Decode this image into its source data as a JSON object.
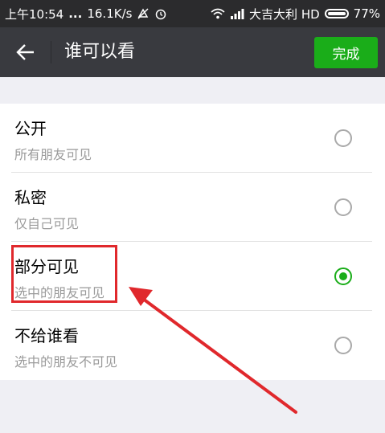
{
  "status_bar": {
    "time": "上午10:54",
    "dots": "...",
    "speed": "16.1K/s",
    "carrier": "大吉大利 HD",
    "battery": "77%"
  },
  "title_bar": {
    "title": "谁可以看",
    "done_label": "完成"
  },
  "options": [
    {
      "title": "公开",
      "subtitle": "所有朋友可见",
      "selected": false
    },
    {
      "title": "私密",
      "subtitle": "仅自己可见",
      "selected": false
    },
    {
      "title": "部分可见",
      "subtitle": "选中的朋友可见",
      "selected": true
    },
    {
      "title": "不给谁看",
      "subtitle": "选中的朋友不可见",
      "selected": false
    }
  ],
  "colors": {
    "accent_green": "#1aad19",
    "annotation_red": "#e0282c",
    "title_bar_bg": "#393a3f",
    "status_bar_bg": "#2b2b2d"
  }
}
